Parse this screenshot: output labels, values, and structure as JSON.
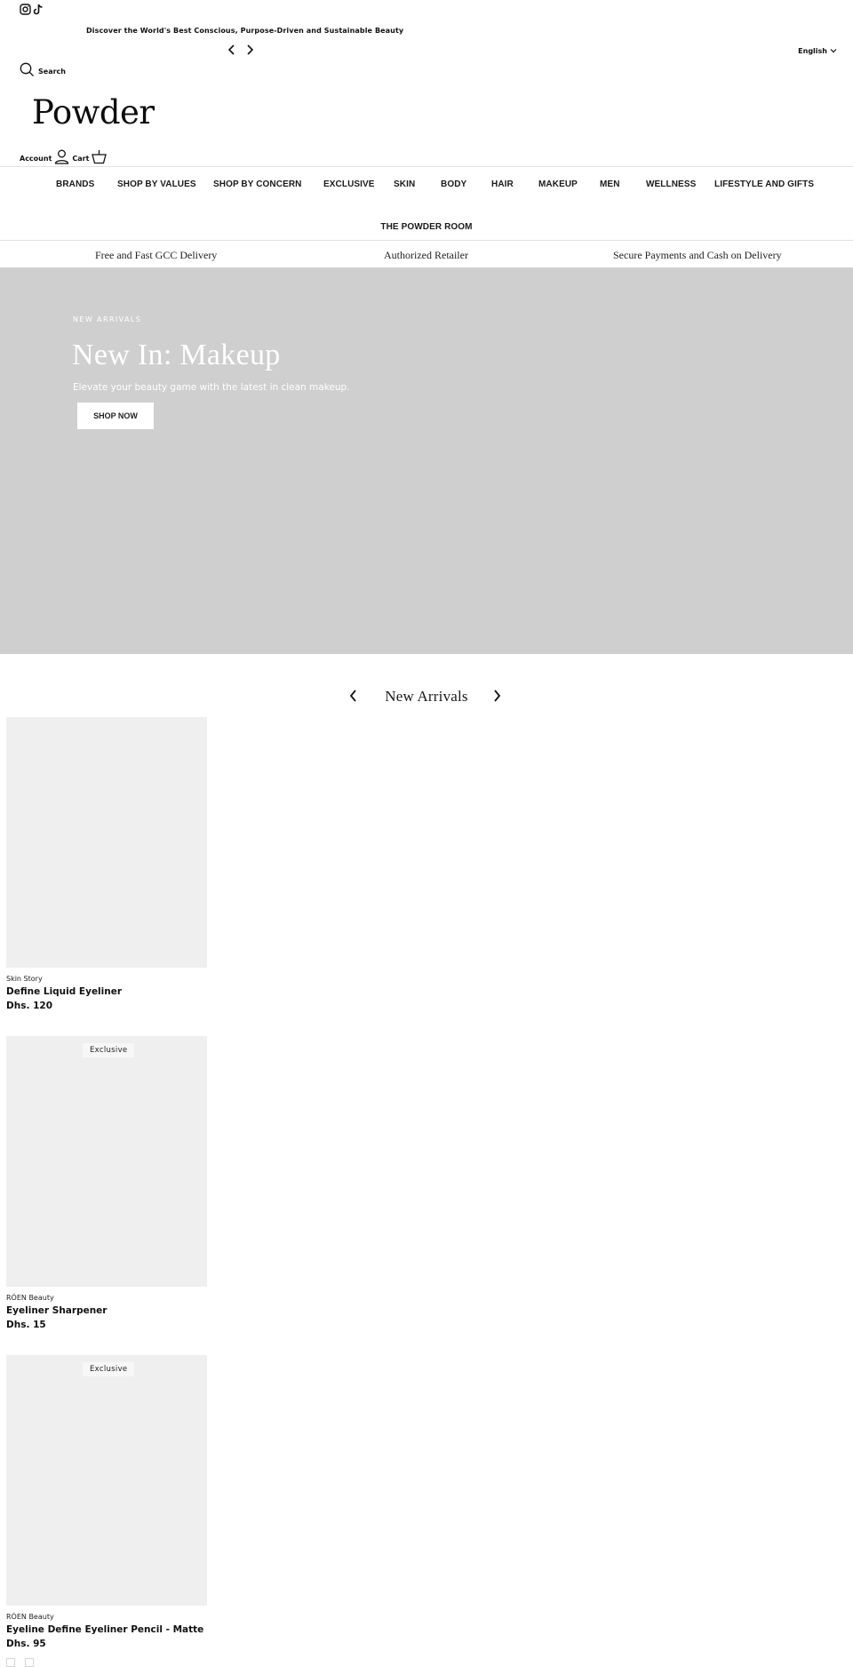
{
  "header": {
    "social": [
      {
        "icon": "instagram-icon",
        "label": "Instagram"
      },
      {
        "icon": "tiktok-icon",
        "label": "TikTok"
      }
    ],
    "announcement": "Discover the World's Best Conscious, Purpose-Driven and Sustainable Beauty",
    "language": "English",
    "search_label": "Search",
    "logo": "Powder",
    "account_label": "Account",
    "cart_label": "Cart"
  },
  "nav": {
    "items": [
      "BRANDS",
      "SHOP BY VALUES",
      "SHOP BY CONCERN",
      "EXCLUSIVE",
      "SKIN",
      "BODY",
      "HAIR",
      "MAKEUP",
      "MEN",
      "WELLNESS",
      "LIFESTYLE AND GIFTS"
    ],
    "second_row": [
      "THE POWDER ROOM"
    ]
  },
  "usp": [
    "Free and Fast GCC Delivery",
    "Authorized Retailer",
    "Secure Payments and Cash on Delivery"
  ],
  "hero": {
    "kicker": "NEW ARRIVALS",
    "title": "New In: Makeup",
    "subtitle": "Elevate your beauty game with the latest in clean makeup.",
    "button": "SHOP NOW",
    "background": "#cfcfcf"
  },
  "new_arrivals": {
    "title": "New Arrivals",
    "products": [
      {
        "brand": "Skin Story",
        "name": "Define Liquid Eyeliner",
        "price": "Dhs. 120",
        "badge": null
      },
      {
        "brand": "RÓEN Beauty",
        "name": "Eyeliner Sharpener",
        "price": "Dhs. 15",
        "badge": "Exclusive"
      },
      {
        "brand": "RÓEN Beauty",
        "name": "Eyeline Define Eyeliner Pencil - Matte",
        "price": "Dhs. 95",
        "badge": "Exclusive",
        "swatch_count": 2
      }
    ]
  },
  "colors": {
    "text": "#111111",
    "image_placeholder": "#efefef",
    "hero_bg": "#cfcfcf",
    "divider": "#e2e2e2"
  }
}
